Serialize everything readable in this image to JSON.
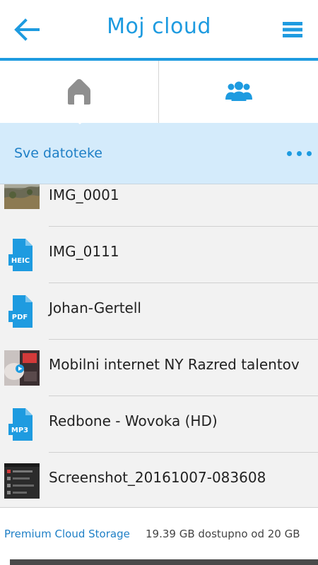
{
  "header": {
    "title": "Moj cloud",
    "back_icon": "arrow-left-icon",
    "menu_icon": "hamburger-menu-icon",
    "accent": "#1e9be0"
  },
  "tabs": [
    {
      "icon": "home-icon",
      "selected": true
    },
    {
      "icon": "users-group-icon",
      "selected": false
    }
  ],
  "breadcrumb": {
    "label": "Sve datoteke",
    "more_icon": "more-dots-icon"
  },
  "files": [
    {
      "name": "IMG_0001",
      "thumb": "photo-landscape"
    },
    {
      "name": "IMG_0111",
      "thumb": "heic-file-icon",
      "badge": "HEIC"
    },
    {
      "name": "Johan-Gertell",
      "thumb": "pdf-file-icon",
      "badge": "PDF"
    },
    {
      "name": "Mobilni internet NY Razred talentov",
      "thumb": "video-thumbnail"
    },
    {
      "name": "Redbone - Wovoka (HD)",
      "thumb": "mp3-file-icon",
      "badge": "MP3"
    },
    {
      "name": "Screenshot_20161007-083608",
      "thumb": "screenshot-thumbnail"
    }
  ],
  "footer": {
    "label": "Premium Cloud Storage",
    "available": "19.39 GB dostupno od 20 GB"
  }
}
